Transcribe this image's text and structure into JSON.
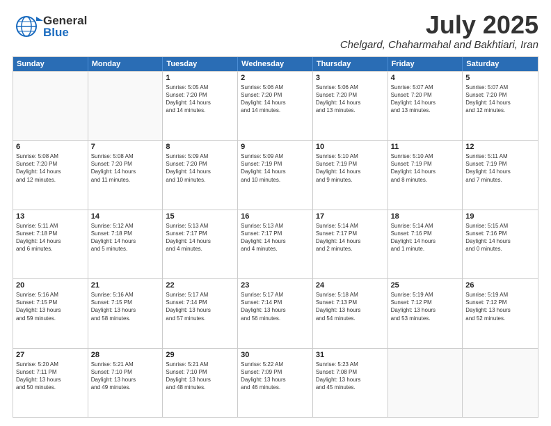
{
  "header": {
    "logo_general": "General",
    "logo_blue": "Blue",
    "title": "July 2025",
    "location": "Chelgard, Chaharmahal and Bakhtiari, Iran"
  },
  "calendar": {
    "days": [
      "Sunday",
      "Monday",
      "Tuesday",
      "Wednesday",
      "Thursday",
      "Friday",
      "Saturday"
    ],
    "rows": [
      [
        {
          "day": "",
          "info": ""
        },
        {
          "day": "",
          "info": ""
        },
        {
          "day": "1",
          "info": "Sunrise: 5:05 AM\nSunset: 7:20 PM\nDaylight: 14 hours\nand 14 minutes."
        },
        {
          "day": "2",
          "info": "Sunrise: 5:06 AM\nSunset: 7:20 PM\nDaylight: 14 hours\nand 14 minutes."
        },
        {
          "day": "3",
          "info": "Sunrise: 5:06 AM\nSunset: 7:20 PM\nDaylight: 14 hours\nand 13 minutes."
        },
        {
          "day": "4",
          "info": "Sunrise: 5:07 AM\nSunset: 7:20 PM\nDaylight: 14 hours\nand 13 minutes."
        },
        {
          "day": "5",
          "info": "Sunrise: 5:07 AM\nSunset: 7:20 PM\nDaylight: 14 hours\nand 12 minutes."
        }
      ],
      [
        {
          "day": "6",
          "info": "Sunrise: 5:08 AM\nSunset: 7:20 PM\nDaylight: 14 hours\nand 12 minutes."
        },
        {
          "day": "7",
          "info": "Sunrise: 5:08 AM\nSunset: 7:20 PM\nDaylight: 14 hours\nand 11 minutes."
        },
        {
          "day": "8",
          "info": "Sunrise: 5:09 AM\nSunset: 7:20 PM\nDaylight: 14 hours\nand 10 minutes."
        },
        {
          "day": "9",
          "info": "Sunrise: 5:09 AM\nSunset: 7:19 PM\nDaylight: 14 hours\nand 10 minutes."
        },
        {
          "day": "10",
          "info": "Sunrise: 5:10 AM\nSunset: 7:19 PM\nDaylight: 14 hours\nand 9 minutes."
        },
        {
          "day": "11",
          "info": "Sunrise: 5:10 AM\nSunset: 7:19 PM\nDaylight: 14 hours\nand 8 minutes."
        },
        {
          "day": "12",
          "info": "Sunrise: 5:11 AM\nSunset: 7:19 PM\nDaylight: 14 hours\nand 7 minutes."
        }
      ],
      [
        {
          "day": "13",
          "info": "Sunrise: 5:11 AM\nSunset: 7:18 PM\nDaylight: 14 hours\nand 6 minutes."
        },
        {
          "day": "14",
          "info": "Sunrise: 5:12 AM\nSunset: 7:18 PM\nDaylight: 14 hours\nand 5 minutes."
        },
        {
          "day": "15",
          "info": "Sunrise: 5:13 AM\nSunset: 7:17 PM\nDaylight: 14 hours\nand 4 minutes."
        },
        {
          "day": "16",
          "info": "Sunrise: 5:13 AM\nSunset: 7:17 PM\nDaylight: 14 hours\nand 4 minutes."
        },
        {
          "day": "17",
          "info": "Sunrise: 5:14 AM\nSunset: 7:17 PM\nDaylight: 14 hours\nand 2 minutes."
        },
        {
          "day": "18",
          "info": "Sunrise: 5:14 AM\nSunset: 7:16 PM\nDaylight: 14 hours\nand 1 minute."
        },
        {
          "day": "19",
          "info": "Sunrise: 5:15 AM\nSunset: 7:16 PM\nDaylight: 14 hours\nand 0 minutes."
        }
      ],
      [
        {
          "day": "20",
          "info": "Sunrise: 5:16 AM\nSunset: 7:15 PM\nDaylight: 13 hours\nand 59 minutes."
        },
        {
          "day": "21",
          "info": "Sunrise: 5:16 AM\nSunset: 7:15 PM\nDaylight: 13 hours\nand 58 minutes."
        },
        {
          "day": "22",
          "info": "Sunrise: 5:17 AM\nSunset: 7:14 PM\nDaylight: 13 hours\nand 57 minutes."
        },
        {
          "day": "23",
          "info": "Sunrise: 5:17 AM\nSunset: 7:14 PM\nDaylight: 13 hours\nand 56 minutes."
        },
        {
          "day": "24",
          "info": "Sunrise: 5:18 AM\nSunset: 7:13 PM\nDaylight: 13 hours\nand 54 minutes."
        },
        {
          "day": "25",
          "info": "Sunrise: 5:19 AM\nSunset: 7:12 PM\nDaylight: 13 hours\nand 53 minutes."
        },
        {
          "day": "26",
          "info": "Sunrise: 5:19 AM\nSunset: 7:12 PM\nDaylight: 13 hours\nand 52 minutes."
        }
      ],
      [
        {
          "day": "27",
          "info": "Sunrise: 5:20 AM\nSunset: 7:11 PM\nDaylight: 13 hours\nand 50 minutes."
        },
        {
          "day": "28",
          "info": "Sunrise: 5:21 AM\nSunset: 7:10 PM\nDaylight: 13 hours\nand 49 minutes."
        },
        {
          "day": "29",
          "info": "Sunrise: 5:21 AM\nSunset: 7:10 PM\nDaylight: 13 hours\nand 48 minutes."
        },
        {
          "day": "30",
          "info": "Sunrise: 5:22 AM\nSunset: 7:09 PM\nDaylight: 13 hours\nand 46 minutes."
        },
        {
          "day": "31",
          "info": "Sunrise: 5:23 AM\nSunset: 7:08 PM\nDaylight: 13 hours\nand 45 minutes."
        },
        {
          "day": "",
          "info": ""
        },
        {
          "day": "",
          "info": ""
        }
      ]
    ]
  }
}
